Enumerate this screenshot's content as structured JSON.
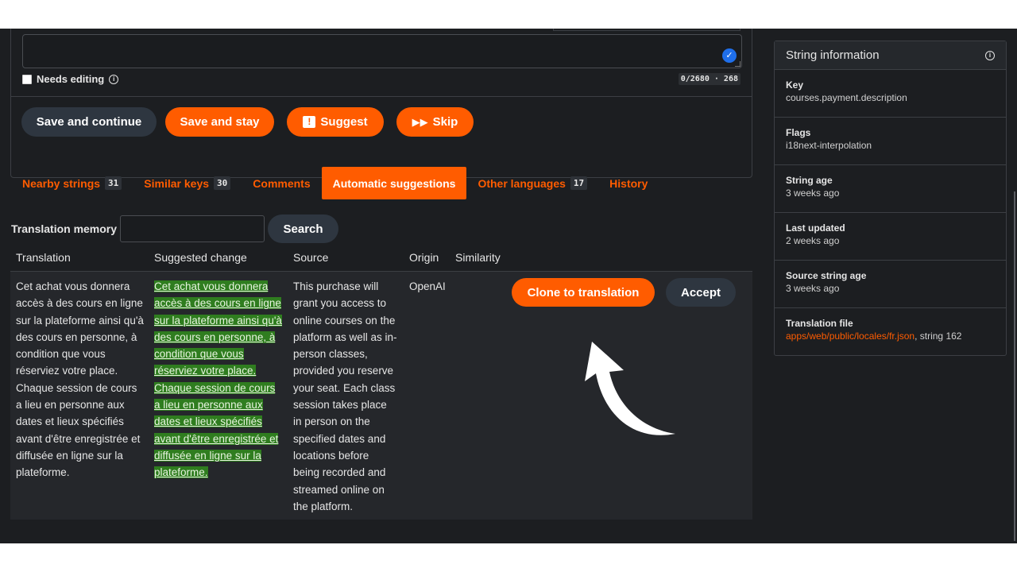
{
  "editor": {
    "needs_editing_label": "Needs editing",
    "counter": "0/2680 · 268",
    "buttons": {
      "save_continue": "Save and continue",
      "save_stay": "Save and stay",
      "suggest": "Suggest",
      "skip": "Skip"
    }
  },
  "tabs": [
    {
      "label": "Nearby strings",
      "count": "31"
    },
    {
      "label": "Similar keys",
      "count": "30"
    },
    {
      "label": "Comments"
    },
    {
      "label": "Automatic suggestions"
    },
    {
      "label": "Other languages",
      "count": "17"
    },
    {
      "label": "History"
    }
  ],
  "memory": {
    "label": "Translation memory",
    "search_button": "Search"
  },
  "table": {
    "headers": [
      "Translation",
      "Suggested change",
      "Source",
      "Origin",
      "Similarity"
    ],
    "row": {
      "translation": "Cet achat vous donnera accès à des cours en ligne sur la plateforme ainsi qu'à des cours en personne, à condition que vous réserviez votre place. Chaque session de cours a lieu en personne aux dates et lieux spécifiés avant d'être enregistrée et diffusée en ligne sur la plateforme.",
      "suggested": "Cet achat vous donnera accès à des cours en ligne sur la plateforme ainsi qu'à des cours en personne, à condition que vous réserviez votre place. Chaque session de cours a lieu en personne aux dates et lieux spécifiés avant d'être enregistrée et diffusée en ligne sur la plateforme.",
      "source": "This purchase will grant you access to online courses on the platform as well as in-person classes, provided you reserve your seat. Each class session takes place in person on the specified dates and locations before being recorded and streamed online on the platform.",
      "origin": "OpenAI",
      "clone_button": "Clone to translation",
      "accept_button": "Accept"
    }
  },
  "string_info": {
    "title": "String information",
    "items": [
      {
        "label": "Key",
        "value": "courses.payment.description"
      },
      {
        "label": "Flags",
        "value": "i18next-interpolation"
      },
      {
        "label": "String age",
        "value": "3 weeks ago"
      },
      {
        "label": "Last updated",
        "value": "2 weeks ago"
      },
      {
        "label": "Source string age",
        "value": "3 weeks ago"
      },
      {
        "label": "Translation file",
        "link": "apps/web/public/locales/fr.json",
        "suffix": ", string 162"
      }
    ]
  },
  "colors": {
    "accent": "#ff5c00",
    "background": "#1c1e21",
    "dark_button": "#2e3640",
    "highlight": "#2f7d1f"
  }
}
